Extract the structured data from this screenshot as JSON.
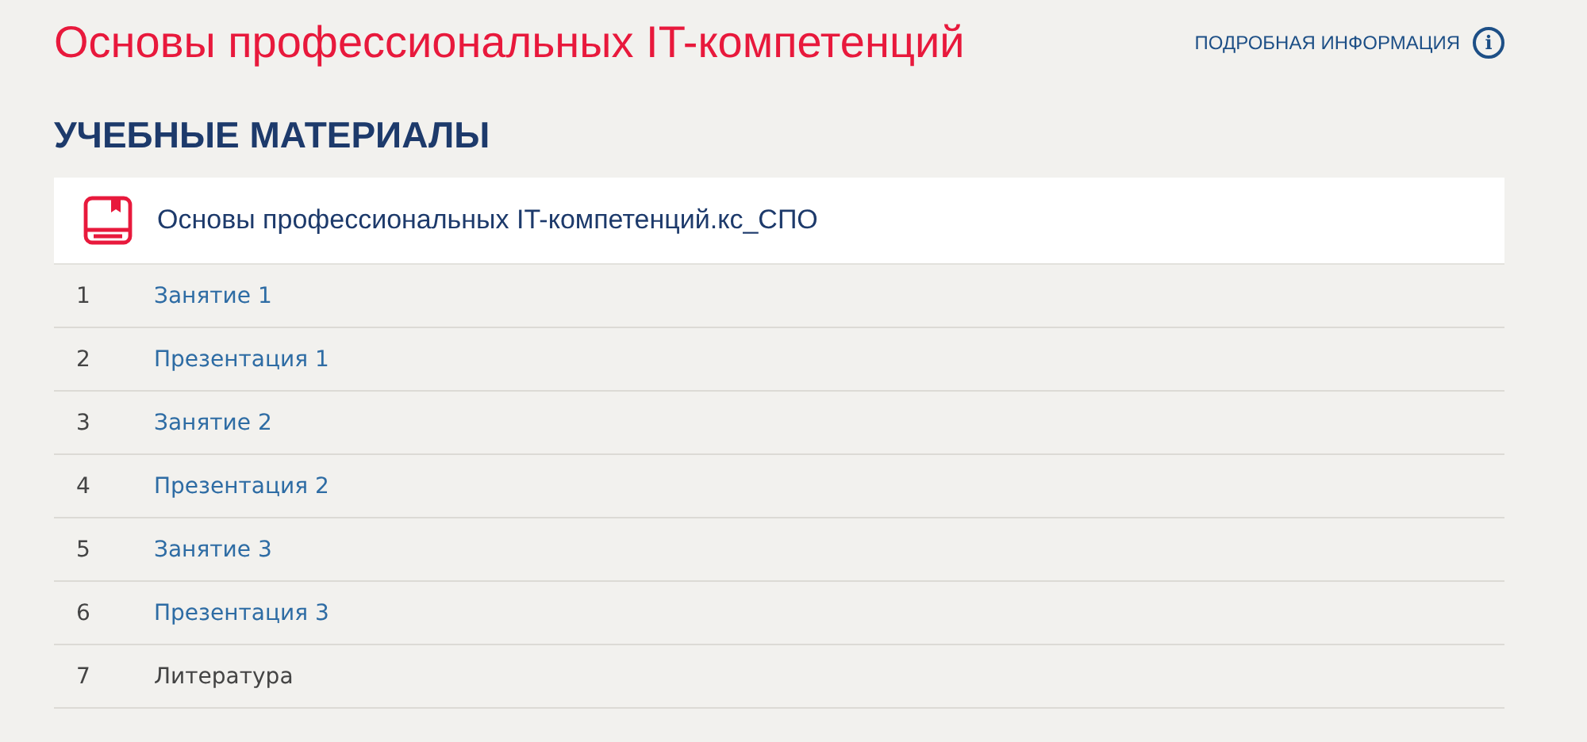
{
  "page_title": "Основы профессиональных IT-компетенций",
  "info_link": {
    "label": "ПОДРОБНАЯ ИНФОРМАЦИЯ",
    "icon": "i"
  },
  "section_title": "УЧЕБНЫЕ МАТЕРИАЛЫ",
  "course": {
    "title": "Основы профессиональных IT-компетенций.кс_СПО"
  },
  "items": [
    {
      "number": "1",
      "title": "Занятие 1",
      "link": true
    },
    {
      "number": "2",
      "title": "Презентация 1",
      "link": true
    },
    {
      "number": "3",
      "title": "Занятие 2",
      "link": true
    },
    {
      "number": "4",
      "title": "Презентация 2",
      "link": true
    },
    {
      "number": "5",
      "title": "Занятие 3",
      "link": true
    },
    {
      "number": "6",
      "title": "Презентация 3",
      "link": true
    },
    {
      "number": "7",
      "title": "Литература",
      "link": false
    }
  ]
}
